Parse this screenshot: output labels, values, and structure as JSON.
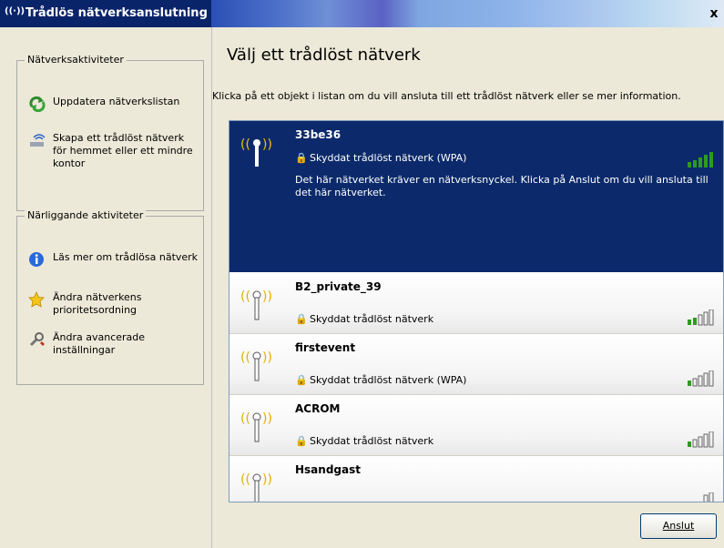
{
  "window": {
    "title": "Trådlös nätverksanslutning",
    "close_label": "x"
  },
  "sidebar": {
    "network_tasks": {
      "title": "Nätverksaktiviteter",
      "items": [
        {
          "label": "Uppdatera nätverkslistan",
          "icon": "refresh-icon"
        },
        {
          "label": "Skapa ett trådlöst nätverk för hemmet eller ett mindre kontor",
          "icon": "wireless-setup-icon"
        }
      ]
    },
    "related_tasks": {
      "title": "Närliggande aktiviteter",
      "items": [
        {
          "label": "Läs mer om trådlösa nätverk",
          "icon": "info-icon"
        },
        {
          "label": "Ändra nätverkens prioritetsordning",
          "icon": "star-icon"
        },
        {
          "label": "Ändra avancerade inställningar",
          "icon": "settings-icon"
        }
      ]
    }
  },
  "main": {
    "heading": "Välj ett trådlöst nätverk",
    "instruction": "Klicka på ett objekt i listan om du vill ansluta till ett trådlöst nätverk eller se mer information.",
    "networks": [
      {
        "ssid": "33be36",
        "security": "Skyddat trådlöst nätverk (WPA)",
        "description": "Det här nätverket kräver en nätverksnyckel. Klicka på Anslut om du vill ansluta till det här nätverket.",
        "selected": true,
        "signal_bars": 5
      },
      {
        "ssid": "B2_private_39",
        "security": "Skyddat trådlöst nätverk",
        "signal_bars": 2
      },
      {
        "ssid": "firstevent",
        "security": "Skyddat trådlöst nätverk (WPA)",
        "signal_bars": 1
      },
      {
        "ssid": "ACROM",
        "security": "Skyddat trådlöst nätverk",
        "signal_bars": 1
      },
      {
        "ssid": "Hsandgast",
        "security": "",
        "signal_bars": 0
      }
    ],
    "connect_label": "Anslut"
  },
  "colors": {
    "selected_bg": "#0c2a6b",
    "title_bg": "#0a246a",
    "signal_green": "#2e9a1e",
    "page_bg": "#ece9d8"
  }
}
